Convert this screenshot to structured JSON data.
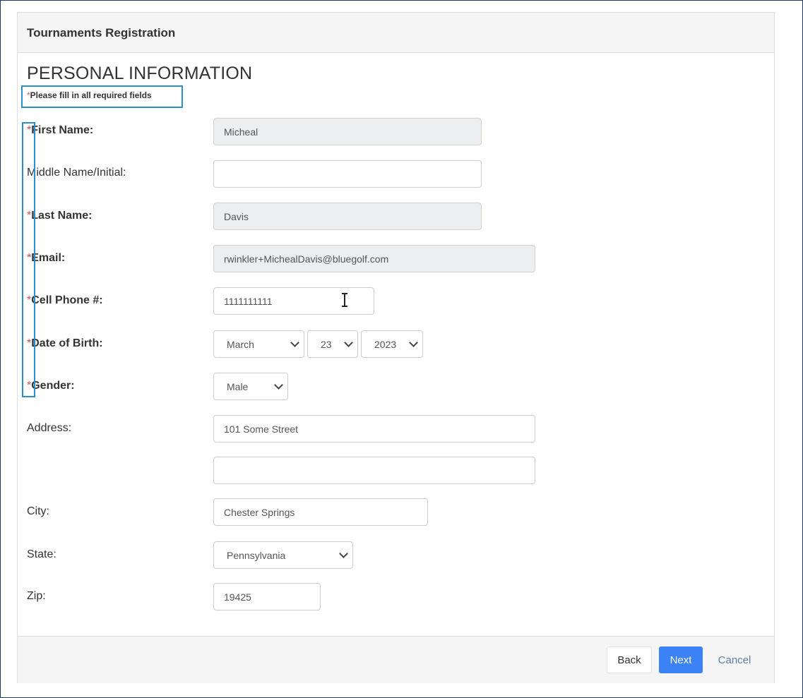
{
  "header": {
    "title": "Tournaments Registration"
  },
  "section": {
    "title": "PERSONAL INFORMATION",
    "required_star": "*",
    "required_note": "Please fill in all required fields"
  },
  "fields": {
    "first_name": {
      "label": "First Name:",
      "value": "Micheal"
    },
    "middle_name": {
      "label": "Middle Name/Initial:",
      "value": ""
    },
    "last_name": {
      "label": "Last Name:",
      "value": "Davis"
    },
    "email": {
      "label": "Email:",
      "value": "rwinkler+MichealDavis@bluegolf.com"
    },
    "cell_phone": {
      "label": "Cell Phone #:",
      "value": "1111111111"
    },
    "dob": {
      "label": "Date of Birth:",
      "month": "March",
      "day": "23",
      "year": "2023"
    },
    "gender": {
      "label": "Gender:",
      "value": "Male"
    },
    "address": {
      "label": "Address:",
      "line1": "101 Some Street",
      "line2": ""
    },
    "city": {
      "label": "City:",
      "value": "Chester Springs"
    },
    "state": {
      "label": "State:",
      "value": "Pennsylvania"
    },
    "zip": {
      "label": "Zip:",
      "value": "19425"
    }
  },
  "footer": {
    "back": "Back",
    "next": "Next",
    "cancel": "Cancel"
  },
  "colors": {
    "required_star": "#d9534f",
    "highlight": "#2a8fd1",
    "primary_button": "#3b82f6"
  }
}
